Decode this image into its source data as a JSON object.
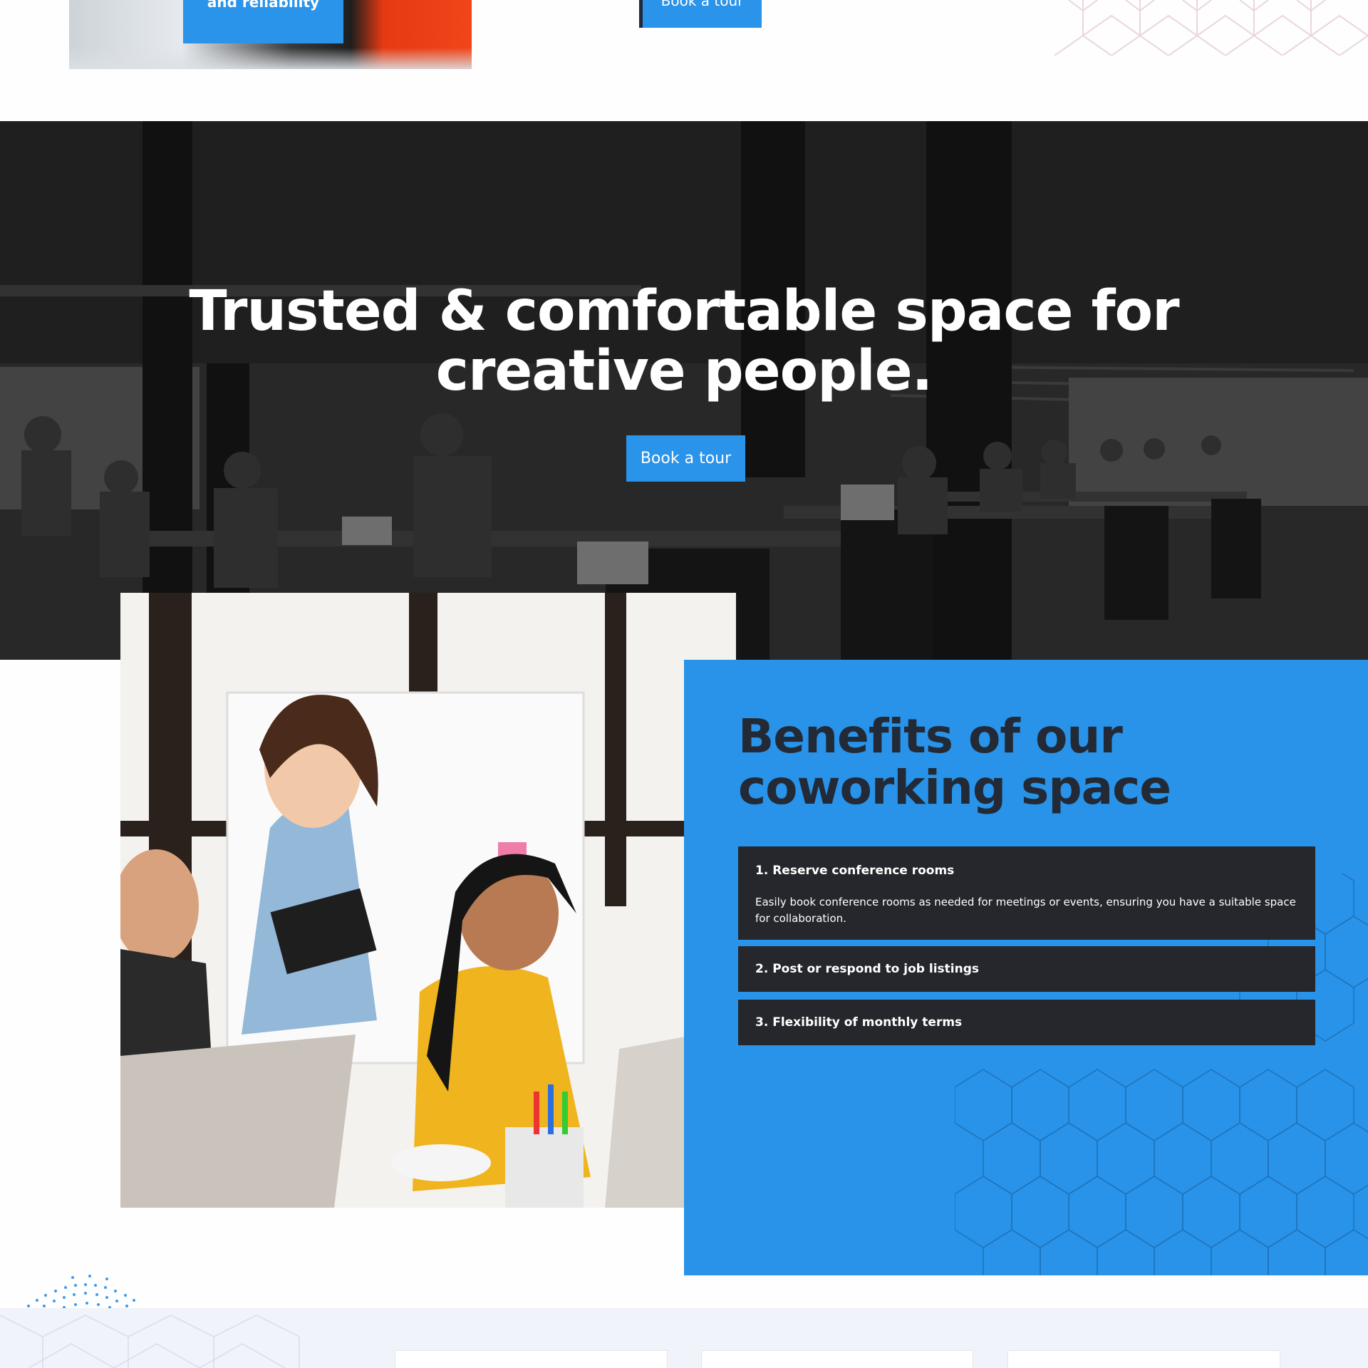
{
  "top": {
    "left_button_label": "and reliability",
    "tour_button_label": "Book a tour"
  },
  "hero": {
    "title_line1": "Trusted & comfortable space for",
    "title_line2": "creative people.",
    "button_label": "Book a tour"
  },
  "benefits": {
    "title": "Benefits of our coworking space",
    "items": [
      {
        "title": "1. Reserve conference rooms",
        "body": "Easily book conference rooms as needed for meetings or events, ensuring you have a suitable space for collaboration.",
        "expanded": true
      },
      {
        "title": "2. Post or respond to job listings",
        "expanded": false
      },
      {
        "title": "3. Flexibility of monthly terms",
        "expanded": false
      }
    ]
  },
  "colors": {
    "accent_blue": "#2a93ea",
    "panel_blue": "#2893e8",
    "accordion_dark": "#26272c",
    "heading_dark": "#232a36",
    "bottom_bg": "#f0f3f9"
  }
}
